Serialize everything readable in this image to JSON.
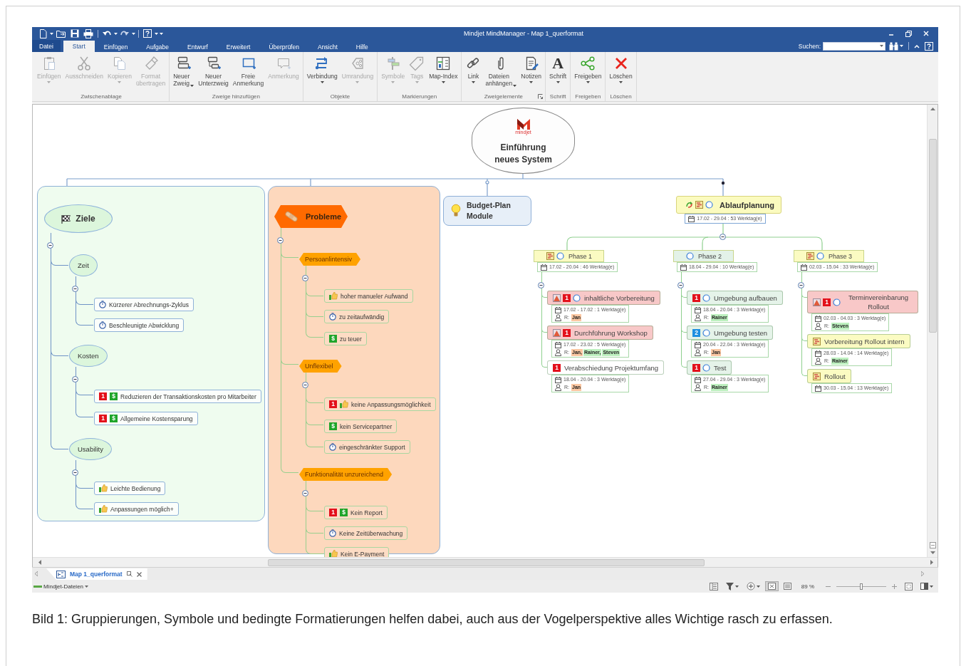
{
  "window": {
    "title": "Mindjet MindManager - Map 1_querformat"
  },
  "ribbon_tabs": [
    {
      "label": "Datei",
      "kind": "backstage",
      "selected": false
    },
    {
      "label": "Start",
      "kind": "tab",
      "selected": true
    },
    {
      "label": "Einfügen",
      "kind": "tab",
      "selected": false
    },
    {
      "label": "Aufgabe",
      "kind": "tab",
      "selected": false
    },
    {
      "label": "Entwurf",
      "kind": "tab",
      "selected": false
    },
    {
      "label": "Erweitert",
      "kind": "tab",
      "selected": false
    },
    {
      "label": "Überprüfen",
      "kind": "tab",
      "selected": false
    },
    {
      "label": "Ansicht",
      "kind": "tab",
      "selected": false
    },
    {
      "label": "Hilfe",
      "kind": "tab",
      "selected": false
    }
  ],
  "search": {
    "label": "Suchen:"
  },
  "ribbon_groups": [
    {
      "label": "Zwischenablage",
      "launcher": false,
      "buttons": [
        {
          "label": "Einfügen",
          "disabled": true,
          "dropdown": true
        },
        {
          "label": "Ausschneiden",
          "disabled": true,
          "dropdown": false
        },
        {
          "label": "Kopieren",
          "disabled": true,
          "dropdown": true
        },
        {
          "label": "Format\nübertragen",
          "disabled": true,
          "dropdown": false
        }
      ]
    },
    {
      "label": "Zweige hinzufügen",
      "launcher": false,
      "buttons": [
        {
          "label": "Neuer\nZweig",
          "disabled": false,
          "dropdown": true
        },
        {
          "label": "Neuer\nUnterzweig",
          "disabled": false,
          "dropdown": false
        },
        {
          "label": "Freie\nAnmerkung",
          "disabled": false,
          "dropdown": false
        },
        {
          "label": "Anmerkung",
          "disabled": true,
          "dropdown": false
        }
      ]
    },
    {
      "label": "Objekte",
      "launcher": false,
      "buttons": [
        {
          "label": "Verbindung",
          "disabled": false,
          "dropdown": true
        },
        {
          "label": "Umrandung",
          "disabled": true,
          "dropdown": true
        }
      ]
    },
    {
      "label": "Markierungen",
      "launcher": false,
      "buttons": [
        {
          "label": "Symbole",
          "disabled": true,
          "dropdown": true
        },
        {
          "label": "Tags",
          "disabled": true,
          "dropdown": true
        },
        {
          "label": "Map-Index",
          "disabled": false,
          "dropdown": true
        }
      ]
    },
    {
      "label": "Zweigelemente",
      "launcher": true,
      "buttons": [
        {
          "label": "Link",
          "disabled": false,
          "dropdown": true
        },
        {
          "label": "Dateien\nanhängen",
          "disabled": false,
          "dropdown": true
        },
        {
          "label": "Notizen",
          "disabled": false,
          "dropdown": true
        }
      ]
    },
    {
      "label": "Schrift",
      "launcher": false,
      "buttons": [
        {
          "label": "Schrift",
          "glyph": "A",
          "disabled": false,
          "dropdown": true
        }
      ]
    },
    {
      "label": "Freigeben",
      "launcher": false,
      "buttons": [
        {
          "label": "Freigeben",
          "disabled": false,
          "dropdown": true
        }
      ]
    },
    {
      "label": "Löschen",
      "launcher": false,
      "buttons": [
        {
          "label": "Löschen",
          "disabled": false,
          "dropdown": true
        }
      ]
    }
  ],
  "map": {
    "central": {
      "logo_text": "mindjet",
      "title": "Einführung neues System"
    },
    "topics": [
      {
        "kind": "ellipse-tree",
        "boundary": {
          "color": "#effcef"
        },
        "title": "Ziele",
        "markers": [
          {
            "kind": "goal"
          }
        ],
        "expanded": true,
        "children": [
          {
            "title": "Zeit",
            "kind": "ellipse",
            "expanded": true,
            "children": [
              {
                "title": "Kürzerer Abrechnungs-Zyklus",
                "kind": "box",
                "markers": [
                  {
                    "kind": "time"
                  }
                ]
              },
              {
                "title": "Beschleunigte Abwicklung",
                "kind": "box",
                "markers": [
                  {
                    "kind": "time"
                  }
                ]
              }
            ]
          },
          {
            "title": "Kosten",
            "kind": "ellipse",
            "expanded": true,
            "children": [
              {
                "title": "Reduzieren der Transaktionskosten pro Mitarbeiter",
                "kind": "box",
                "markers": [
                  {
                    "kind": "priority",
                    "label": "1",
                    "color": "#e3101b"
                  },
                  {
                    "kind": "cost",
                    "label": "$"
                  }
                ]
              },
              {
                "title": "Allgemeine Kostensparung",
                "kind": "box",
                "markers": [
                  {
                    "kind": "priority",
                    "label": "1",
                    "color": "#e3101b"
                  },
                  {
                    "kind": "cost",
                    "label": "$"
                  }
                ]
              }
            ]
          },
          {
            "title": "Usability",
            "kind": "ellipse",
            "expanded": true,
            "children": [
              {
                "title": "Leichte Bedienung",
                "kind": "box",
                "markers": [
                  {
                    "kind": "pro"
                  }
                ]
              },
              {
                "title": "Anpassungen möglich+",
                "kind": "box",
                "markers": [
                  {
                    "kind": "pro"
                  }
                ]
              }
            ]
          }
        ]
      },
      {
        "kind": "hexagon-tree",
        "boundary": {
          "color": "#fdd8bd"
        },
        "title": "Probleme",
        "color": "#ff6a00",
        "markers": [
          {
            "kind": "problem"
          }
        ],
        "expanded": true,
        "children": [
          {
            "title": "Persoanlintensiv",
            "kind": "hexagon",
            "expanded": true,
            "children": [
              {
                "title": "hoher manueler Aufwand",
                "kind": "box",
                "markers": [
                  {
                    "kind": "pro"
                  }
                ]
              },
              {
                "title": "zu zeitaufwändig",
                "kind": "box",
                "markers": [
                  {
                    "kind": "time"
                  }
                ]
              },
              {
                "title": "zu teuer",
                "kind": "box",
                "markers": [
                  {
                    "kind": "cost",
                    "label": "$"
                  }
                ]
              }
            ]
          },
          {
            "title": "Unflexibel",
            "kind": "hexagon",
            "expanded": true,
            "children": [
              {
                "title": "keine Anpassungsmöglichkeit",
                "kind": "box",
                "markers": [
                  {
                    "kind": "priority",
                    "label": "1",
                    "color": "#e3101b"
                  },
                  {
                    "kind": "pro"
                  }
                ]
              },
              {
                "title": "kein Servicepartner",
                "kind": "box",
                "markers": [
                  {
                    "kind": "cost",
                    "label": "$"
                  }
                ]
              },
              {
                "title": "eingeschränkter Support",
                "kind": "box",
                "markers": [
                  {
                    "kind": "time"
                  }
                ]
              }
            ]
          },
          {
            "title": "Funktionalität unzureichend",
            "kind": "hexagon",
            "expanded": true,
            "children": [
              {
                "title": "Kein Report",
                "kind": "box",
                "markers": [
                  {
                    "kind": "priority",
                    "label": "1",
                    "color": "#e3101b"
                  },
                  {
                    "kind": "cost",
                    "label": "$"
                  }
                ]
              },
              {
                "title": "Keine Zeitüberwachung",
                "kind": "box",
                "markers": [
                  {
                    "kind": "time"
                  }
                ]
              },
              {
                "title": "Kein E-Payment",
                "kind": "box",
                "markers": [
                  {
                    "kind": "pro"
                  }
                ]
              }
            ]
          }
        ]
      },
      {
        "kind": "single",
        "title": "Budget-Plan Module",
        "markers": [
          {
            "kind": "idea"
          }
        ]
      },
      {
        "kind": "schedule",
        "title": "Ablaufplanung",
        "markers": [
          {
            "kind": "resource-sync"
          },
          {
            "kind": "task-info"
          },
          {
            "kind": "task-progress"
          }
        ],
        "date": "17.02 - 29.04 : 53 Werktag(e)",
        "expanded": true,
        "phases": [
          {
            "title": "Phase 1",
            "color": "#fbfbc2",
            "markers": [
              {
                "kind": "task-info"
              },
              {
                "kind": "task-progress"
              }
            ],
            "date": "17.02 - 20.04 : 46 Werktag(e)",
            "expanded": true,
            "tasks": [
              {
                "title": "inhaltliche Vorbereitung",
                "color": "#f8c8c8",
                "markers": [
                  {
                    "kind": "risk"
                  },
                  {
                    "kind": "priority",
                    "label": "1",
                    "color": "#e3101b"
                  },
                  {
                    "kind": "task-progress"
                  }
                ],
                "date": "17.02 - 17.02 : 1 Werktag(e)",
                "resource_label": "R:",
                "resources": [
                  {
                    "name": "Jan",
                    "color": "#fbc7a2"
                  }
                ]
              },
              {
                "title": "Durchführung Workshop",
                "color": "#f8c8c8",
                "markers": [
                  {
                    "kind": "risk"
                  },
                  {
                    "kind": "priority",
                    "label": "1",
                    "color": "#e3101b"
                  }
                ],
                "date": "17.02 - 23.02 : 5 Werktag(e)",
                "resource_label": "R:",
                "resources": [
                  {
                    "name": "Jan,",
                    "color": "#fbc7a2"
                  },
                  {
                    "name": "Rainer,",
                    "color": "#bdf0bf"
                  },
                  {
                    "name": "Steven",
                    "color": "#bdf0bf"
                  }
                ]
              },
              {
                "title": "Verabschiedung Projektumfang",
                "color": "#ffffff",
                "markers": [
                  {
                    "kind": "priority",
                    "label": "1",
                    "color": "#e3101b"
                  }
                ],
                "date": "18.04 - 20.04 : 3 Werktag(e)",
                "resource_label": "R:",
                "resources": [
                  {
                    "name": "Jan",
                    "color": "#fbc7a2"
                  }
                ]
              }
            ]
          },
          {
            "title": "Phase 2",
            "color": "#e3f2e8",
            "markers": [
              {
                "kind": "task-progress"
              }
            ],
            "date": "18.04 - 29.04 : 10 Werktag(e)",
            "expanded": true,
            "tasks": [
              {
                "title": "Umgebung aufbauen",
                "color": "#e5f3e9",
                "markers": [
                  {
                    "kind": "priority",
                    "label": "1",
                    "color": "#e3101b"
                  },
                  {
                    "kind": "task-progress"
                  }
                ],
                "date": "18.04 - 20.04 : 3 Werktag(e)",
                "resource_label": "R:",
                "resources": [
                  {
                    "name": "Rainer",
                    "color": "#bdf0bf"
                  }
                ]
              },
              {
                "title": "Umgebung testen",
                "color": "#e5f3e9",
                "markers": [
                  {
                    "kind": "priority",
                    "label": "2",
                    "color": "#1e8fe0"
                  },
                  {
                    "kind": "task-progress"
                  }
                ],
                "date": "20.04 - 22.04 : 3 Werktag(e)",
                "resource_label": "R:",
                "resources": [
                  {
                    "name": "Jan",
                    "color": "#fbc7a2"
                  }
                ]
              },
              {
                "title": "Test",
                "color": "#e5f3e9",
                "markers": [
                  {
                    "kind": "priority",
                    "label": "1",
                    "color": "#e3101b"
                  },
                  {
                    "kind": "task-progress"
                  }
                ],
                "date": "27.04 - 29.04 : 3 Werktag(e)",
                "resource_label": "R:",
                "resources": [
                  {
                    "name": "Rainer",
                    "color": "#bdf0bf"
                  }
                ]
              }
            ]
          },
          {
            "title": "Phase 3",
            "color": "#fbfbc2",
            "markers": [
              {
                "kind": "task-info"
              },
              {
                "kind": "task-progress"
              }
            ],
            "date": "02.03 - 15.04 : 33 Werktag(e)",
            "expanded": true,
            "tasks": [
              {
                "title": "Terminvereinbarung Rollout",
                "color": "#f8c8c8",
                "markers": [
                  {
                    "kind": "risk"
                  },
                  {
                    "kind": "priority",
                    "label": "1",
                    "color": "#e3101b"
                  },
                  {
                    "kind": "task-progress"
                  }
                ],
                "date": "02.03 - 04.03 : 3 Werktag(e)",
                "resource_label": "R:",
                "resources": [
                  {
                    "name": "Steven",
                    "color": "#bdf0bf"
                  }
                ]
              },
              {
                "title": "Vorbereitung Rollout intern",
                "color": "#fbfbc2",
                "markers": [
                  {
                    "kind": "task-info"
                  }
                ],
                "date": "28.03 - 14.04 : 14 Werktag(e)",
                "resource_label": "R:",
                "resources": [
                  {
                    "name": "Rainer",
                    "color": "#bdf0bf"
                  }
                ]
              },
              {
                "title": "Rollout",
                "color": "#fbfbc2",
                "markers": [
                  {
                    "kind": "task-info"
                  }
                ],
                "date": "30.03 - 15.04 : 13 Werktag(e)"
              }
            ]
          }
        ]
      }
    ]
  },
  "document_tabs": [
    {
      "label": "Map 1_querformat",
      "selected": true
    }
  ],
  "status_bar": {
    "library": "Mindjet-Dateien",
    "view_buttons": [
      {
        "selected": true
      },
      {
        "selected": false
      }
    ],
    "zoom": "89 %",
    "zoom_slider": {
      "level": 0.5
    }
  },
  "caption": "Bild 1: Gruppierungen, Symbole und bedingte Formatierungen helfen dabei, auch aus der Vogelperspektive alles Wichtige rasch zu erfassen."
}
